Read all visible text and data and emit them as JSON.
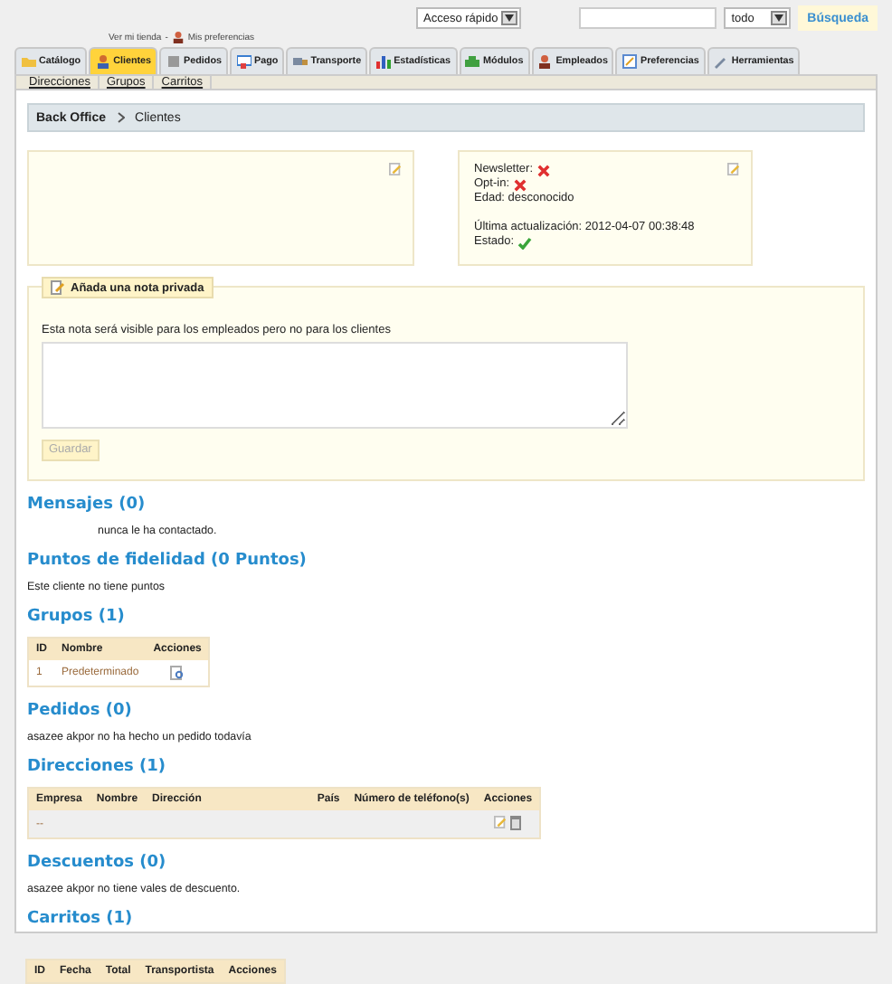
{
  "top_bar": {
    "quick_access": "Acceso rápido",
    "search_scope": "todo",
    "search_button": "Búsqueda"
  },
  "header_links": {
    "shop": "Ver mi tienda",
    "separator": "-",
    "preferences": "Mis preferencias"
  },
  "tabs": [
    {
      "label": "Catálogo",
      "selected": false
    },
    {
      "label": "Clientes",
      "selected": true
    },
    {
      "label": "Pedidos",
      "selected": false
    },
    {
      "label": "Pago",
      "selected": false
    },
    {
      "label": "Transporte",
      "selected": false
    },
    {
      "label": "Estadísticas",
      "selected": false
    },
    {
      "label": "Módulos",
      "selected": false
    },
    {
      "label": "Empleados",
      "selected": false
    },
    {
      "label": "Preferencias",
      "selected": false
    },
    {
      "label": "Herramientas",
      "selected": false
    }
  ],
  "subnav": [
    "Direcciones",
    "Grupos",
    "Carritos"
  ],
  "breadcrumb": [
    "Back Office",
    "Clientes"
  ],
  "customer_info": [
    {
      "kind": "flag",
      "label": "Newsletter:",
      "on": false
    },
    {
      "kind": "flag",
      "label": "Opt-in:",
      "on": false
    },
    {
      "kind": "text",
      "label": "Edad: desconocido"
    },
    {
      "kind": "gap"
    },
    {
      "kind": "text",
      "label": "Última actualización: 2012-04-07 00:38:48"
    },
    {
      "kind": "flag",
      "label": "Estado:",
      "on": true
    }
  ],
  "private_note": {
    "legend": "Añada una nota privada",
    "hint": "Esta nota será visible para los empleados pero no para los clientes",
    "button": {
      "label": "Guardar",
      "disabled": true
    }
  },
  "sections": [
    {
      "heading": "Mensajes (0)",
      "kind": "indented_text",
      "text": "nunca le ha contactado."
    },
    {
      "heading": "Puntos de fidelidad (0 Puntos)",
      "kind": "text",
      "text": "Este cliente no tiene puntos"
    },
    {
      "heading": "Grupos (1)",
      "kind": "group_table",
      "columns": [
        "ID",
        "Nombre",
        "Acciones"
      ],
      "rows": [
        {
          "cells": [
            "1",
            "Predeterminado"
          ]
        }
      ]
    },
    {
      "heading": "Pedidos (0)",
      "kind": "text",
      "text": "asazee akpor no ha hecho un pedido todavía"
    },
    {
      "heading": "Direcciones (1)",
      "kind": "address_table",
      "columns": [
        "Empresa",
        "Nombre",
        "Dirección",
        "País",
        "Número de teléfono(s)",
        "Acciones"
      ],
      "rows": [
        {
          "cells": [
            "--"
          ]
        }
      ]
    },
    {
      "heading": "Descuentos (0)",
      "kind": "text",
      "text": "asazee akpor no tiene vales de descuento."
    },
    {
      "heading": "Carritos (1)",
      "kind": "heading"
    }
  ],
  "carts_table": {
    "columns": [
      "ID",
      "Fecha",
      "Total",
      "Transportista",
      "Acciones"
    ]
  }
}
